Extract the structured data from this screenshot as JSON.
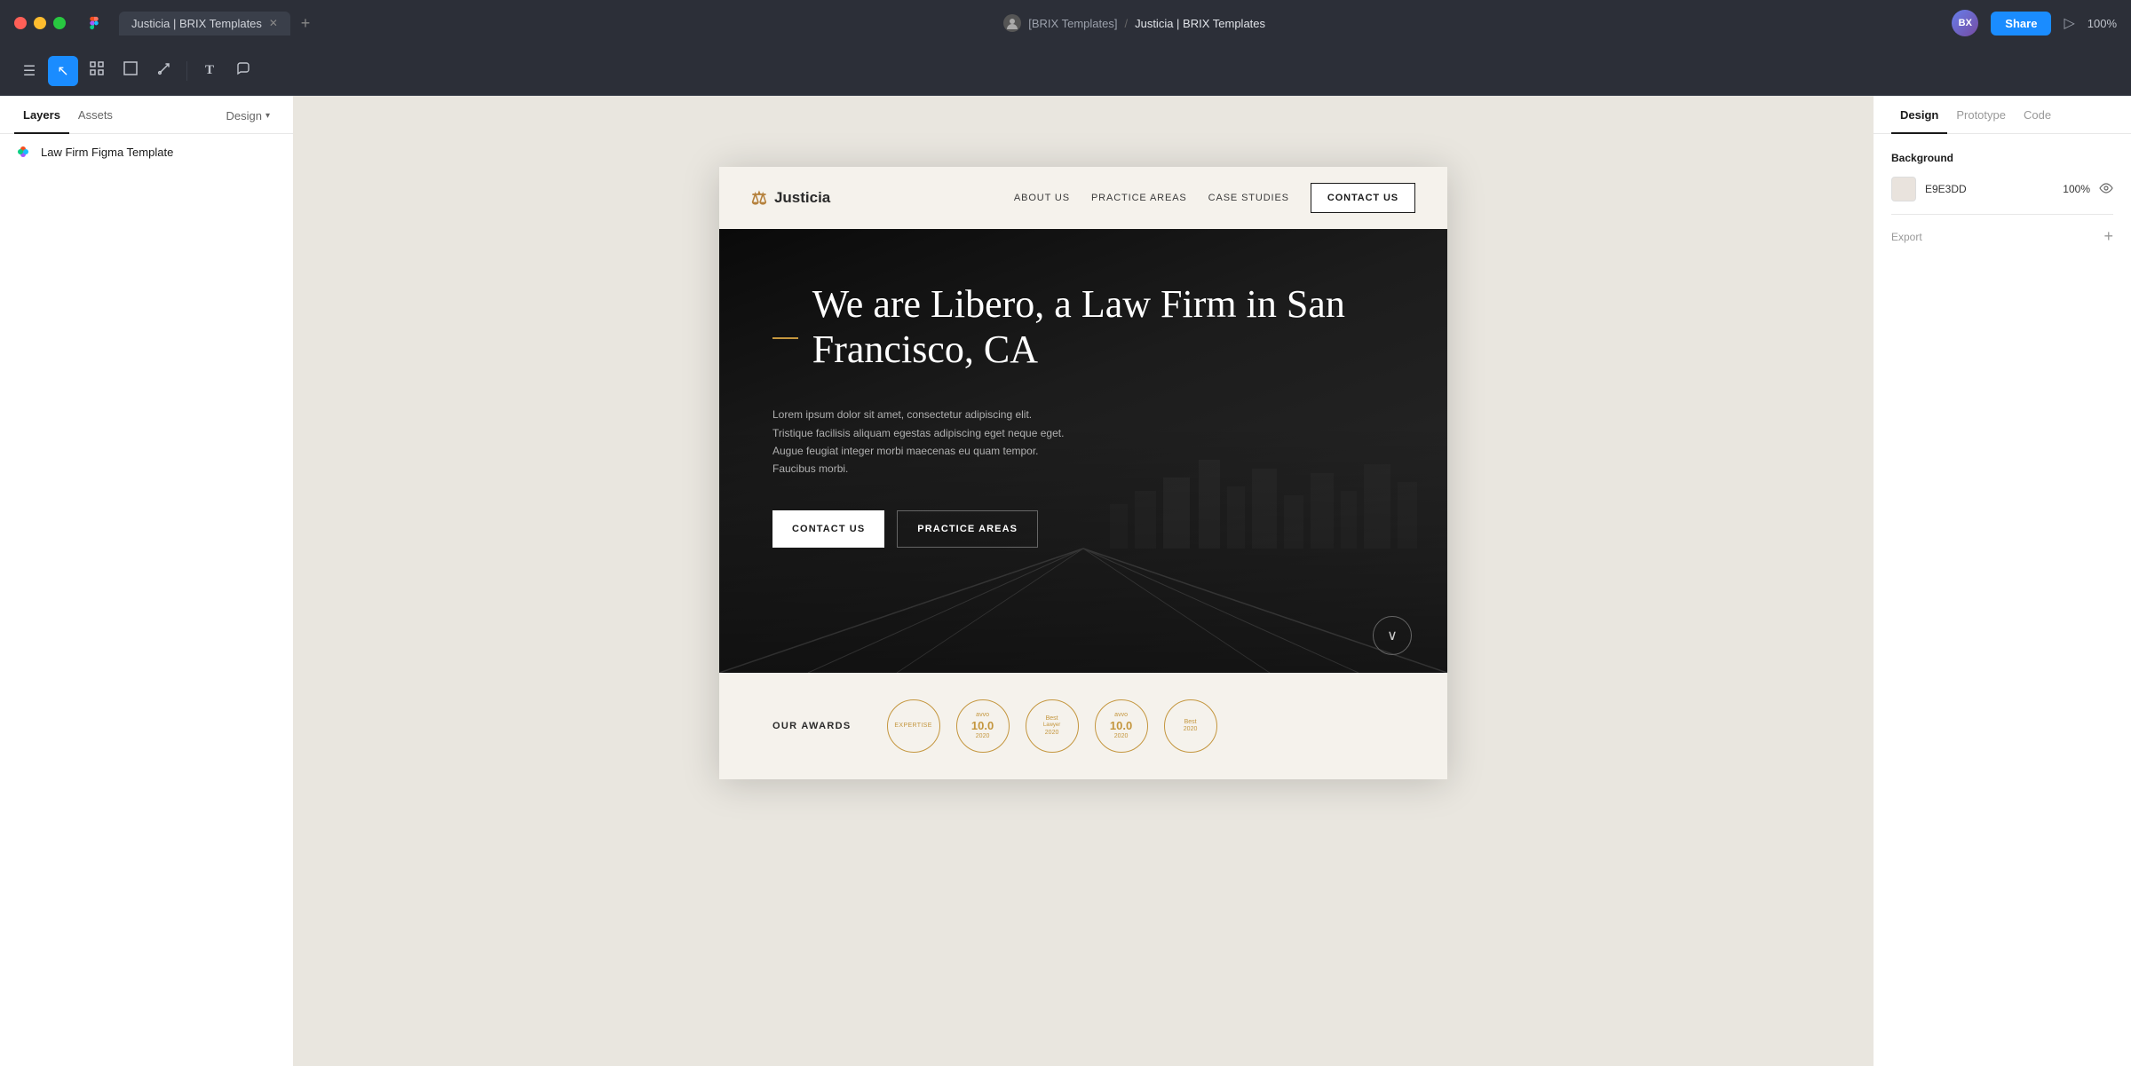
{
  "titlebar": {
    "tab_label": "Justicia | BRIX Templates",
    "breadcrumb_team": "[BRIX Templates]",
    "breadcrumb_sep": "/",
    "breadcrumb_file": "Justicia | BRIX Templates",
    "share_label": "Share",
    "zoom_label": "100%"
  },
  "toolbar": {
    "menu_icon": "☰",
    "select_icon": "↖",
    "frame_icon": "#",
    "shape_icon": "□",
    "pen_icon": "✒",
    "text_icon": "T",
    "comment_icon": "💬",
    "play_icon": "▷"
  },
  "left_panel": {
    "tabs": [
      "Layers",
      "Assets"
    ],
    "design_tab": "Design",
    "layers": [
      {
        "name": "Law Firm Figma Template"
      }
    ]
  },
  "right_panel": {
    "tabs": [
      "Design",
      "Prototype",
      "Code"
    ],
    "background_label": "Background",
    "color_hex": "E9E3DD",
    "color_opacity": "100%",
    "export_label": "Export"
  },
  "site": {
    "logo_text": "Justicia",
    "nav_links": [
      "ABOUT US",
      "PRACTICE AREAS",
      "CASE STUDIES"
    ],
    "nav_cta": "CONTACT US",
    "hero_title": "We are Libero, a Law Firm in San Francisco, CA",
    "hero_desc": "Lorem ipsum dolor sit amet, consectetur adipiscing elit. Tristique facilisis aliquam egestas adipiscing eget neque eget. Augue feugiat integer morbi maecenas eu quam tempor. Faucibus morbi.",
    "hero_btn1": "CONTACT US",
    "hero_btn2": "PRACTICE AREAS",
    "awards_title": "OUR AWARDS",
    "awards": [
      {
        "line1": "Expertise",
        "line2": ""
      },
      {
        "line1": "10.0",
        "line2": "2020"
      },
      {
        "line1": "Best",
        "line2": "Lawyer 2020"
      },
      {
        "line1": "10.0",
        "line2": "2020"
      },
      {
        "line1": "Best",
        "line2": "2020"
      }
    ]
  }
}
